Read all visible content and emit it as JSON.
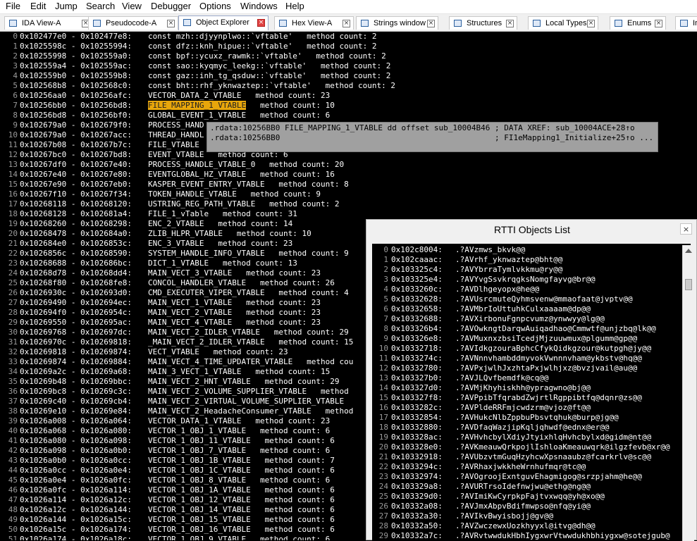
{
  "menu": [
    "File",
    "Edit",
    "Jump",
    "Search",
    "View",
    "Debugger",
    "Options",
    "Windows",
    "Help"
  ],
  "tabs": [
    {
      "label": "IDA View-A",
      "active": false,
      "icon": "ida-view-icon"
    },
    {
      "label": "Pseudocode-A",
      "active": false,
      "icon": "pseudocode-icon"
    },
    {
      "label": "Object Explorer",
      "active": true,
      "icon": "object-explorer-icon"
    },
    {
      "label": "Hex View-A",
      "active": false,
      "icon": "hex-view-icon"
    },
    {
      "label": "Strings window",
      "active": false,
      "icon": "strings-icon"
    },
    {
      "label": "Structures",
      "active": false,
      "icon": "structures-icon"
    },
    {
      "label": "Local Types",
      "active": false,
      "icon": "local-types-icon"
    },
    {
      "label": "Enums",
      "active": false,
      "icon": "enums-icon"
    },
    {
      "label": "Ir",
      "active": false,
      "icon": "imports-icon"
    }
  ],
  "tab_close_glyph": "×",
  "listing": [
    {
      "i": "0",
      "a": "0x102477e0 - 0x102477e8:",
      "d": "const mzh::djyynplwo::`vftable'   method count: 2"
    },
    {
      "i": "1",
      "a": "0x1025598c - 0x10255994:",
      "d": "const dfz::knh_hipue::`vftable'   method count: 2"
    },
    {
      "i": "2",
      "a": "0x10255998 - 0x102559a0:",
      "d": "const bpf::ycuxz_rawmk::`vftable'   method count: 2"
    },
    {
      "i": "3",
      "a": "0x102559a4 - 0x102559ac:",
      "d": "const sao::kyqmyc_leekg::`vftable'   method count: 2"
    },
    {
      "i": "4",
      "a": "0x102559b0 - 0x102559b8:",
      "d": "const gaz::inh_tg_qsduw::`vftable'   method count: 2"
    },
    {
      "i": "5",
      "a": "0x102568b8 - 0x102568c0:",
      "d": "const bht::rhf_yknwaztep::`vftable'   method count: 2"
    },
    {
      "i": "6",
      "a": "0x10256aa0 - 0x10256afc:",
      "d": "VECTOR_DATA_2_VTABLE   method count: 23"
    },
    {
      "i": "7",
      "a": "0x10256bb0 - 0x10256bd8:",
      "hl": "FILE_MAPPING_1_VTABLE",
      "d": "   method count: 10"
    },
    {
      "i": "8",
      "a": "0x10256bd8 - 0x10256bf0:",
      "d": "GLOBAL_EVENT_1_VTABLE   method count: 6"
    },
    {
      "i": "9",
      "a": "0x102679a0 - 0x102679f0:",
      "d": "PROCESS_HAND"
    },
    {
      "i": "10",
      "a": "0x102679a0 - 0x10267acc:",
      "d": "THREAD_HANDL"
    },
    {
      "i": "11",
      "a": "0x10267b08 - 0x10267b7c:",
      "d": "FILE_VTABLE"
    },
    {
      "i": "12",
      "a": "0x10267bc0 - 0x10267bd8:",
      "d": "EVENT_VTABLE   method count: 6"
    },
    {
      "i": "13",
      "a": "0x10267df0 - 0x10267e40:",
      "d": "PROCESS_HANDLE_VTABLE_0   method count: 20"
    },
    {
      "i": "14",
      "a": "0x10267e40 - 0x10267e80:",
      "d": "EVENTGLOBAL_HZ_VTABLE   method count: 16"
    },
    {
      "i": "15",
      "a": "0x10267e90 - 0x10267eb0:",
      "d": "KASPER_EVENT_ENTRY_VTABLE   method count: 8"
    },
    {
      "i": "16",
      "a": "0x10267f10 - 0x10267f34:",
      "d": "TOKEN_HANDLE_VTABLE   method count: 9"
    },
    {
      "i": "17",
      "a": "0x10268118 - 0x10268120:",
      "d": "USTRING_REG_PATH_VTABLE   method count: 2"
    },
    {
      "i": "18",
      "a": "0x10268128 - 0x102681a4:",
      "d": "FILE_1_vTable   method count: 31"
    },
    {
      "i": "19",
      "a": "0x10268260 - 0x10268298:",
      "d": "ENC_2_VTABLE   method count: 14"
    },
    {
      "i": "20",
      "a": "0x10268478 - 0x102684a0:",
      "d": "ZLIB_HLPR_VTABLE   method count: 10"
    },
    {
      "i": "21",
      "a": "0x102684e0 - 0x1026853c:",
      "d": "ENC_3_VTABLE   method count: 23"
    },
    {
      "i": "22",
      "a": "0x1026856c - 0x10268590:",
      "d": "SYSTEM_HANDLE_INFO_VTABLE   method count: 9"
    },
    {
      "i": "23",
      "a": "0x10268688 - 0x102686bc:",
      "d": "DICT_1_VTABLE   method count: 13"
    },
    {
      "i": "24",
      "a": "0x10268d78 - 0x10268dd4:",
      "d": "MAIN_VECT_3_VTABLE   method count: 23"
    },
    {
      "i": "25",
      "a": "0x10268f80 - 0x10268fe8:",
      "d": "CONCOL_HANDLER_VTABLE   method count: 26"
    },
    {
      "i": "26",
      "a": "0x1026930c - 0x102693d0:",
      "d": "CMD_EXECUTER_VIPER_VTABLE   method count: 4"
    },
    {
      "i": "27",
      "a": "0x10269490 - 0x102694ec:",
      "d": "MAIN_VECT_1_VTABLE   method count: 23"
    },
    {
      "i": "28",
      "a": "0x102694f0 - 0x1026954c:",
      "d": "MAIN_VECT_2_VTABLE   method count: 23"
    },
    {
      "i": "29",
      "a": "0x10269550 - 0x102695ac:",
      "d": "MAIN_VECT_4_VTABLE   method count: 23"
    },
    {
      "i": "30",
      "a": "0x10269768 - 0x102697dc:",
      "d": "MAIN_VECT_2_IDLER_VTABLE   method count: 29"
    },
    {
      "i": "31",
      "a": "0x1026970c - 0x10269818:",
      "d": "_MAIN_VECT_2_IDLER_VTABLE   method count: 15"
    },
    {
      "i": "32",
      "a": "0x10269818 - 0x10269874:",
      "d": "VECT_VTABLE   method count: 23"
    },
    {
      "i": "33",
      "a": "0x10269874 - 0x10269884:",
      "d": "MAIN_VECT_4_TIME_UPDATER_VTABLE   method cou"
    },
    {
      "i": "34",
      "a": "0x10269a2c - 0x10269a68:",
      "d": "MAIN_3_VECT_1_VTABLE   method count: 15"
    },
    {
      "i": "35",
      "a": "0x10269b48 - 0x10269bbc:",
      "d": "MAIN_VECT_2_HNT_VTABLE   method count: 29"
    },
    {
      "i": "36",
      "a": "0x10269bc8 - 0x10269c3c:",
      "d": "MAIN_VECT_2_VOLUME_SUPPLIER_VTABLE   method"
    },
    {
      "i": "37",
      "a": "0x10269c40 - 0x10269cb4:",
      "d": "MAIN_VECT_2_VIRTUAL_VOLUME_SUPPLIER_VTABLE"
    },
    {
      "i": "38",
      "a": "0x10269e10 - 0x10269e84:",
      "d": "MAIN_VECT_2_HeadacheConsumer_VTABLE   method"
    },
    {
      "i": "39",
      "a": "0x1026a008 - 0x1026a064:",
      "d": "VECTOR_DATA_1_VTABLE   method count: 23"
    },
    {
      "i": "40",
      "a": "0x1026a068 - 0x1026a080:",
      "d": "VECTOR_1_OBJ_1_VTABLE   method count: 6"
    },
    {
      "i": "41",
      "a": "0x1026a080 - 0x1026a098:",
      "d": "VECTOR_1_OBJ_11_VTABLE   method count: 6"
    },
    {
      "i": "42",
      "a": "0x1026a098 - 0x1026a0b0:",
      "d": "VECTOR_1_OBJ_7_VTABLE   method count: 6"
    },
    {
      "i": "43",
      "a": "0x1026a0b0 - 0x1026a0cc:",
      "d": "VECTOR_1_OBJ_1B_VTABLE   method count: 7"
    },
    {
      "i": "44",
      "a": "0x1026a0cc - 0x1026a0e4:",
      "d": "VECTOR_1_OBJ_1C_VTABLE   method count: 6"
    },
    {
      "i": "45",
      "a": "0x1026a0e4 - 0x1026a0fc:",
      "d": "VECTOR_1_OBJ_8_VTABLE   method count: 6"
    },
    {
      "i": "46",
      "a": "0x1026a0fc - 0x1026a114:",
      "d": "VECTOR_1_OBJ_1A_VTABLE   method count: 6"
    },
    {
      "i": "47",
      "a": "0x1026a114 - 0x1026a12c:",
      "d": "VECTOR_1_OBJ_12_VTABLE   method count: 6"
    },
    {
      "i": "48",
      "a": "0x1026a12c - 0x1026a144:",
      "d": "VECTOR_1_OBJ_14_VTABLE   method count: 6"
    },
    {
      "i": "49",
      "a": "0x1026a144 - 0x1026a15c:",
      "d": "VECTOR_1_OBJ_15_VTABLE   method count: 6"
    },
    {
      "i": "50",
      "a": "0x1026a15c - 0x1026a174:",
      "d": "VECTOR_1_OBJ_16_VTABLE   method count: 6"
    },
    {
      "i": "51",
      "a": "0x1026a174 - 0x1026a18c:",
      "d": "VECTOR_1_OBJ_9_VTABLE   method count: 6"
    }
  ],
  "tooltip": {
    "line1": ".rdata:10256BB0 FILE_MAPPING_1_VTABLE dd offset sub_10004B46 ; DATA XREF: sub_10004ACE+28↑o",
    "line2": ".rdata:10256BB0                                              ; FI1eMapping1_Initialize+25↑o ..."
  },
  "rtti": {
    "title": "RTTI Objects List",
    "close_glyph": "×",
    "rows": [
      {
        "i": "0",
        "a": "0x102c8004:",
        "n": ".?AVzmws_bkvk@@"
      },
      {
        "i": "1",
        "a": "0x102caaac:",
        "n": ".?AVrhf_yknwaztep@bht@@"
      },
      {
        "i": "2",
        "a": "0x103325c4:",
        "n": ".?AVYbrraTymlvkkmu@ry@@"
      },
      {
        "i": "3",
        "a": "0x103325e4:",
        "n": ".?AVYvgSsvkrqgksNomgfayvg@br@@"
      },
      {
        "i": "4",
        "a": "0x1033260c:",
        "n": ".?AVDlhgeyopx@he@@"
      },
      {
        "i": "5",
        "a": "0x10332628:",
        "n": ".?AVUsrcmuteQyhmsvenw@mmaofaat@jvptv@@"
      },
      {
        "i": "6",
        "a": "0x10332658:",
        "n": ".?AVMbrIoUttuhkCulxaaaam@dp@@"
      },
      {
        "i": "7",
        "a": "0x10332688:",
        "n": ".?AVXirbonuFgnpcvumz@ynwwyy@lg@@"
      },
      {
        "i": "8",
        "a": "0x103326b4:",
        "n": ".?AVOwkngtDarqwAuiqadhao@Cmmwtf@unjzbq@lk@@"
      },
      {
        "i": "9",
        "a": "0x103326e8:",
        "n": ".?AVMuxnxzbsiTcedjMjzuuwmux@plgumm@gp@@"
      },
      {
        "i": "10",
        "a": "0x10332718:",
        "n": ".?AVIdkgzouraBphcCfykQidkgzour@kutpgh@jy@@"
      },
      {
        "i": "11",
        "a": "0x1033274c:",
        "n": ".?AVNnnvhambddmyvokVwnnnvham@ykbstv@hq@@"
      },
      {
        "i": "12",
        "a": "0x10332780:",
        "n": ".?AVPxjwlhJxzhtaPxjwlhjxz@bvzjvail@au@@"
      },
      {
        "i": "13",
        "a": "0x103327b0:",
        "n": ".?AVJLQvfbemdfk@cq@@"
      },
      {
        "i": "14",
        "a": "0x103327d0:",
        "n": ".?AVMjKhyhiskhh@ypragwno@bj@@"
      },
      {
        "i": "15",
        "a": "0x103327f8:",
        "n": ".?AVPpibTfqrabdZwjrtlRgppibtfq@dqnr@zs@@"
      },
      {
        "i": "16",
        "a": "0x1033282c:",
        "n": ".?AVPldeRRFmjcwdzrm@vjoz@ft@@"
      },
      {
        "i": "17",
        "a": "0x10332854:",
        "n": ".?AVHukcNlbZppbuPbsvtqhuk@burp@jg@@"
      },
      {
        "i": "18",
        "a": "0x10332880:",
        "n": ".?AVDfaqWazjipKqljqhwdf@ednx@er@@"
      },
      {
        "i": "19",
        "a": "0x103328ac:",
        "n": ".?AVHvhcbylXdiyJtyixhlqHvhcbylxd@gidm@nt@@"
      },
      {
        "i": "20",
        "a": "0x103328e0:",
        "n": ".?AVKmeauwQrkpojlIshloaKmeauwqrk@ilgzfevb@xr@@"
      },
      {
        "i": "21",
        "a": "0x10332918:",
        "n": ".?AVUbzvtmGuqHzyhcwXpsnaaubz@fcarkrlv@sc@@"
      },
      {
        "i": "22",
        "a": "0x1033294c:",
        "n": ".?AVRhaxjwkkheWrnhufmqr@tc@@"
      },
      {
        "i": "23",
        "a": "0x10332974:",
        "n": ".?AVOgroojExntguvEhagmigog@srzpjahm@he@@"
      },
      {
        "i": "24",
        "a": "0x103329a8:",
        "n": ".?AVURTrsoIdefnwjwu@ethg@ng@@"
      },
      {
        "i": "25",
        "a": "0x103329d0:",
        "n": ".?AVImiKwCyrpkpFajtvxwqq@yh@xo@@"
      },
      {
        "i": "26",
        "a": "0x10332a08:",
        "n": ".?AVJmxAbpvBdifmwpso@nfq@yi@@"
      },
      {
        "i": "27",
        "a": "0x10332a30:",
        "n": ".?AVIkvBwyisbojj@gv@@"
      },
      {
        "i": "28",
        "a": "0x10332a50:",
        "n": ".?AVZwczewxUozkhyyxl@itvg@dh@@"
      },
      {
        "i": "29",
        "a": "0x10332a7c:",
        "n": ".?AVRvtwwdukHbhIygxwrVtwwdukhbhiygxw@sotejgub@"
      }
    ]
  }
}
